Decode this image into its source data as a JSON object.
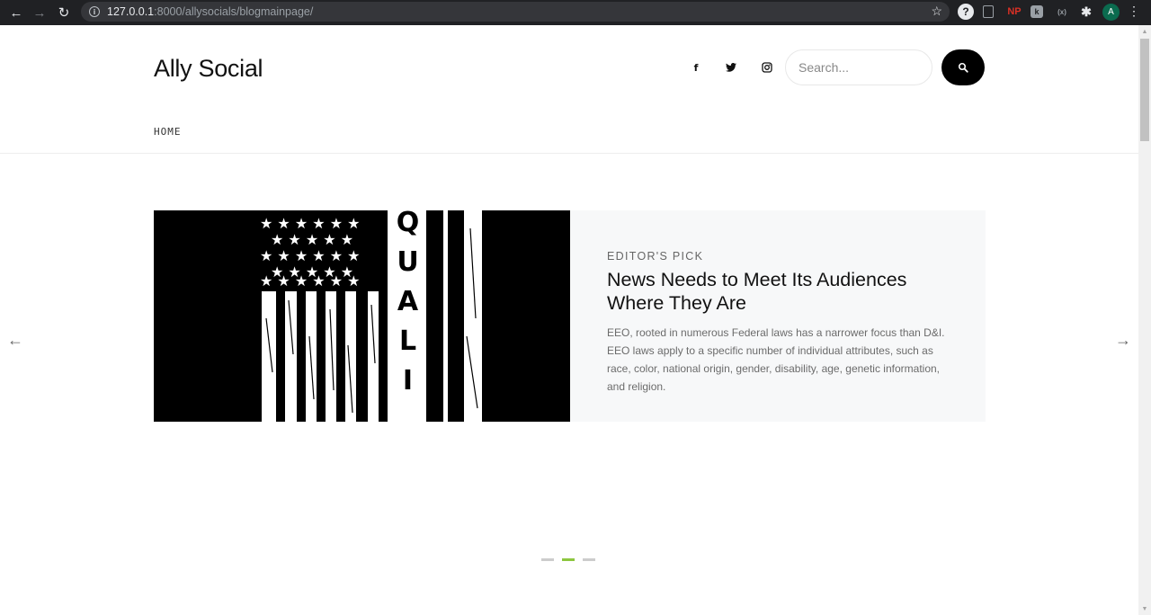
{
  "browser": {
    "url_host": "127.0.0.1",
    "url_rest": ":8000/allysocials/blogmainpage/",
    "ext_np_label": "NP",
    "ext_k_label": "k",
    "ext_x_label": "(x)",
    "avatar_letter": "A",
    "back_icon": "arrow-left",
    "forward_icon": "arrow-right",
    "reload_icon": "reload",
    "info_icon": "info"
  },
  "site": {
    "brand": "Ally Social",
    "social_icons": [
      "facebook",
      "twitter",
      "instagram"
    ],
    "search_placeholder": "Search...",
    "menu": [
      "HOME"
    ]
  },
  "hero": {
    "eyebrow": "EDITOR'S PICK",
    "title": "News Needs to Meet Its Audiences Where They Are",
    "excerpt": "EEO, rooted in numerous Federal laws has a narrower focus than D&I. EEO laws apply to a specific number of individual attributes, such as race, color, national origin, gender, disability, age, genetic information, and religion.",
    "image_letters": [
      "Q",
      "U",
      "A",
      "L",
      "I"
    ],
    "slides_total": 3,
    "active_slide": 2
  },
  "colors": {
    "accent": "#8dc63f",
    "slide_bg": "#f7f8f9",
    "chrome_bg": "#202124"
  }
}
